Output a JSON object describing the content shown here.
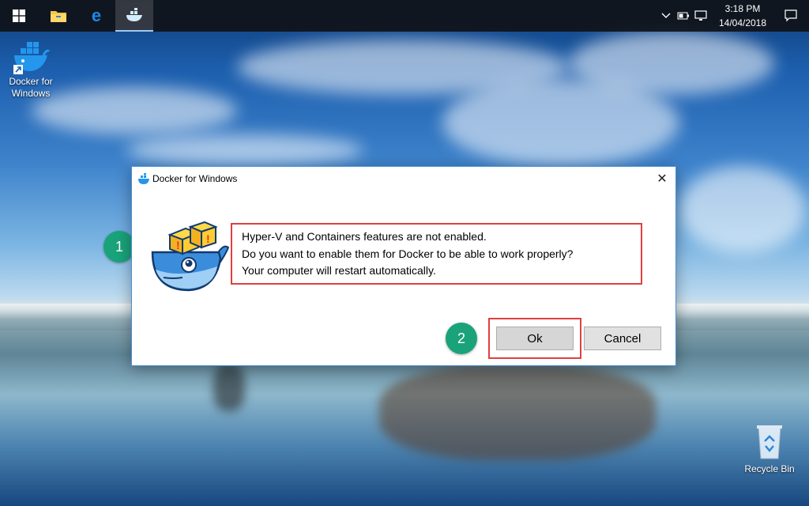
{
  "taskbar": {
    "clock_time": "3:18 PM",
    "clock_date": "14/04/2018",
    "icons": [
      "windows-start-icon",
      "file-explorer-icon",
      "edge-icon",
      "docker-icon"
    ],
    "tray_icons": [
      "chevron-up-icon",
      "battery-icon",
      "network-icon",
      "action-center-icon"
    ]
  },
  "desktop": {
    "icons": [
      {
        "label": "Docker for Windows",
        "icon": "docker-shortcut-icon"
      },
      {
        "label": "Recycle Bin",
        "icon": "recycle-bin-icon"
      }
    ]
  },
  "dialog": {
    "title": "Docker for Windows",
    "close_symbol": "✕",
    "message_lines": [
      "Hyper-V and Containers features are not enabled.",
      "Do you want to enable them for Docker to be able to work properly?",
      "Your computer will restart automatically."
    ],
    "ok_label": "Ok",
    "cancel_label": "Cancel"
  },
  "annotations": {
    "step1": "1",
    "step2": "2",
    "highlight_color": "#e04040",
    "step_color": "#1aa37a"
  }
}
